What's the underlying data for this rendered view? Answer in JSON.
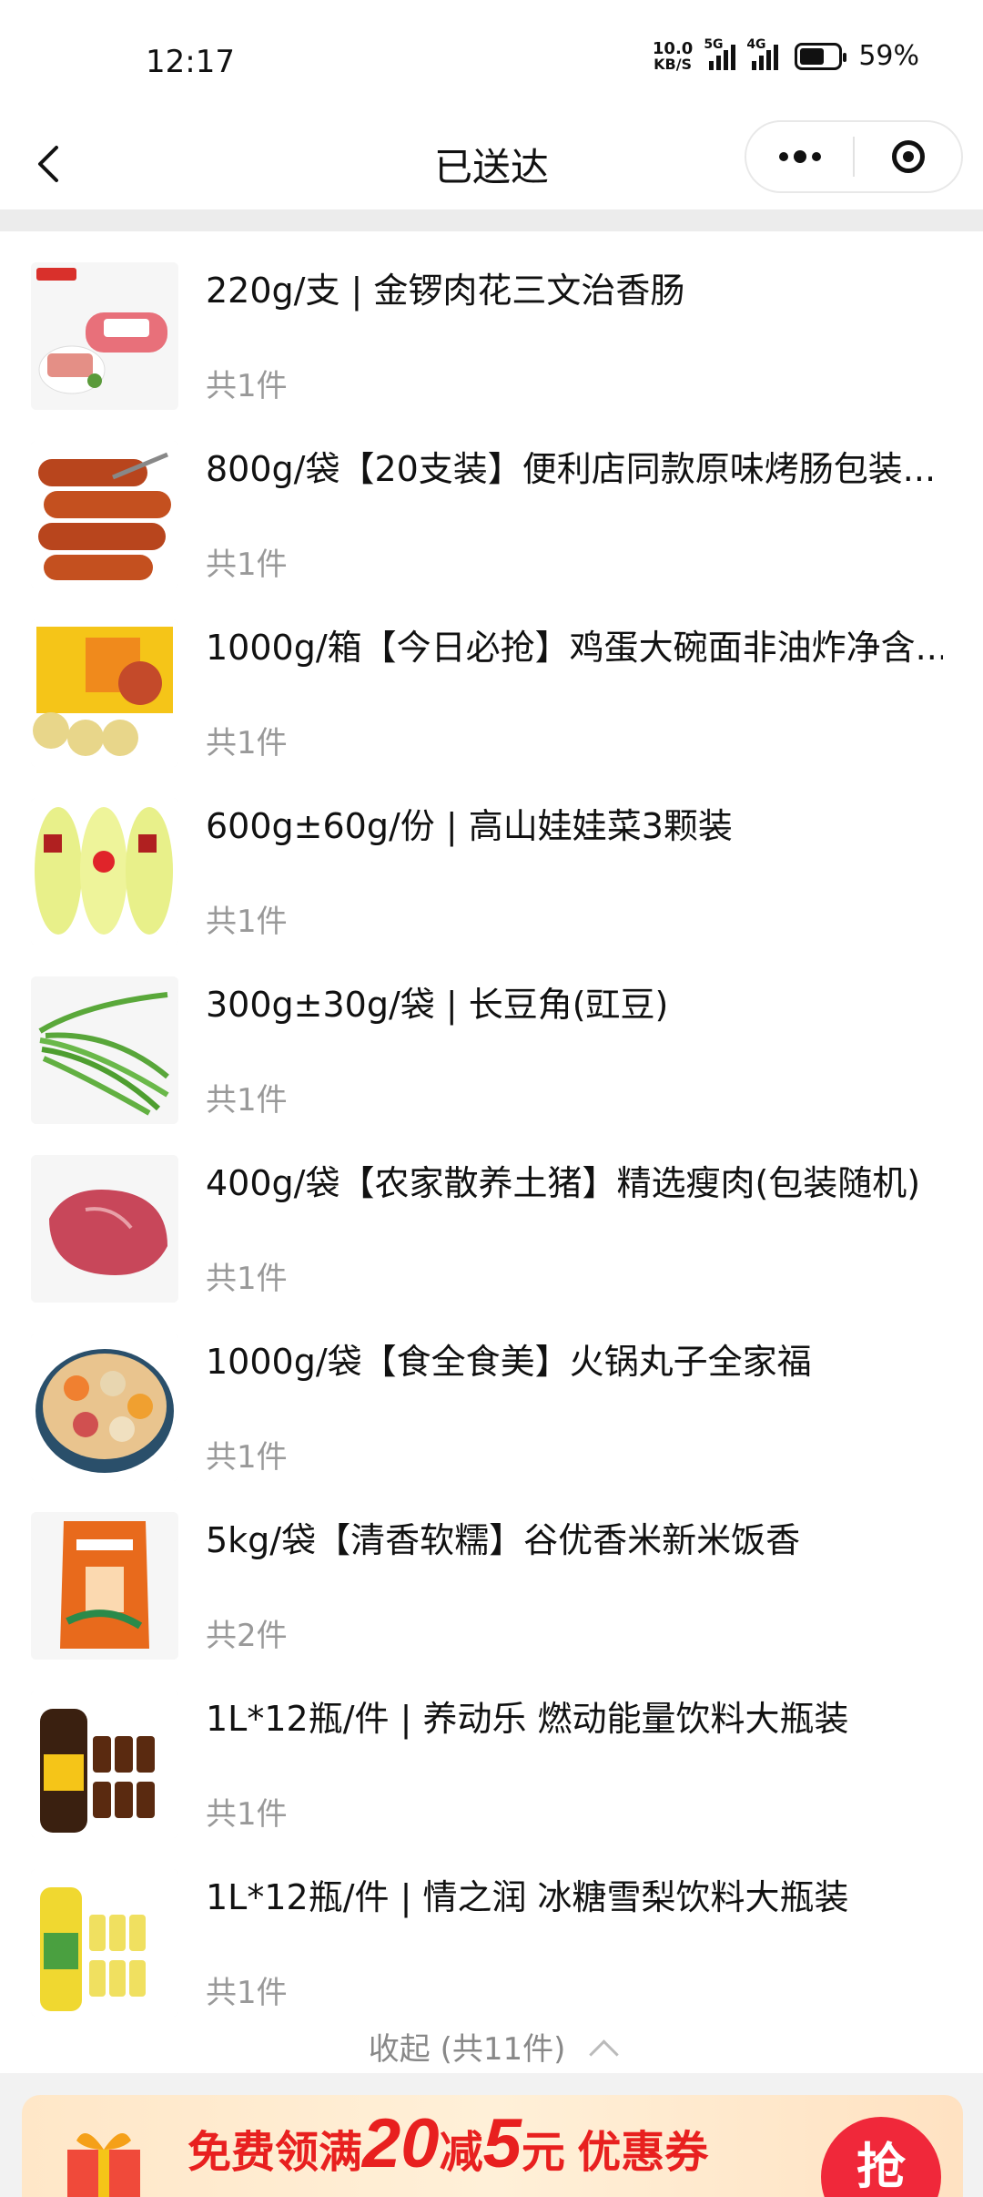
{
  "status_bar": {
    "time": "12:17",
    "net_speed_value": "10.0",
    "net_speed_unit": "KB/S",
    "signal1_label": "5G",
    "signal2_label": "4G",
    "battery": "59%"
  },
  "nav": {
    "title": "已送达"
  },
  "items": [
    {
      "title": "220g/支 | 金锣肉花三文治香肠",
      "qty": "共1件",
      "thumb": "ham-sausage"
    },
    {
      "title": "800g/袋【20支装】便利店同款原味烤肠包装...",
      "qty": "共1件",
      "thumb": "grilled-sausage"
    },
    {
      "title": "1000g/箱【今日必抢】鸡蛋大碗面非油炸净含...",
      "qty": "共1件",
      "thumb": "egg-noodle-box"
    },
    {
      "title": "600g±60g/份 | 高山娃娃菜3颗装",
      "qty": "共1件",
      "thumb": "baby-cabbage"
    },
    {
      "title": "300g±30g/袋 | 长豆角(豇豆)",
      "qty": "共1件",
      "thumb": "long-beans"
    },
    {
      "title": "400g/袋【农家散养土猪】精选瘦肉(包装随机)",
      "qty": "共1件",
      "thumb": "lean-pork"
    },
    {
      "title": "1000g/袋【食全食美】火锅丸子全家福",
      "qty": "共1件",
      "thumb": "hotpot-balls"
    },
    {
      "title": "5kg/袋【清香软糯】谷优香米新米饭香",
      "qty": "共2件",
      "thumb": "rice-bag"
    },
    {
      "title": "1L*12瓶/件 | 养动乐 燃动能量饮料大瓶装",
      "qty": "共1件",
      "thumb": "energy-drink"
    },
    {
      "title": "1L*12瓶/件 | 情之润 冰糖雪梨饮料大瓶装",
      "qty": "共1件",
      "thumb": "pear-drink"
    }
  ],
  "collapse_label": "收起 (共11件)",
  "coupon": {
    "prefix": "免费领满",
    "amount1": "20",
    "mid": "减",
    "amount2": "5",
    "suffix": "元 优惠券",
    "grab": "抢"
  },
  "colors": {
    "accent_red": "#e8201f",
    "muted_text": "#999999"
  }
}
